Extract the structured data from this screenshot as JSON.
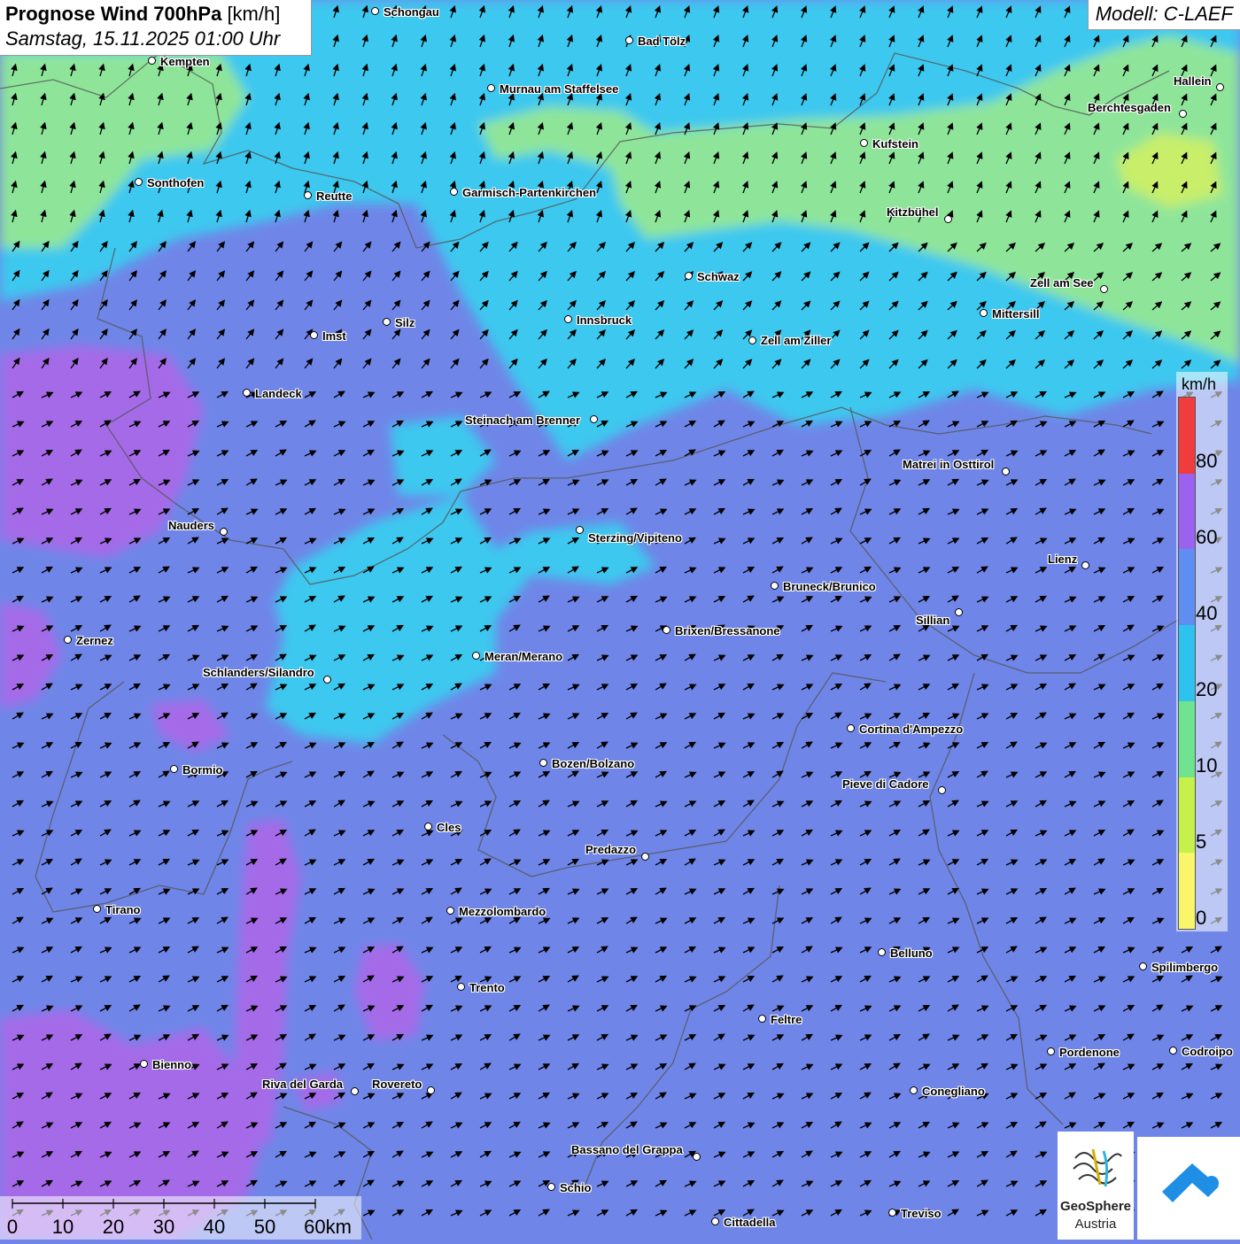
{
  "header": {
    "title_bold": "Prognose Wind 700hPa",
    "title_unit": "[km/h]",
    "datetime": "Samstag, 15.11.2025 01:00 Uhr",
    "model": "Modell: C-LAEF"
  },
  "legend": {
    "unit": "km/h",
    "labels": [
      "80",
      "60",
      "40",
      "20",
      "10",
      "5",
      "0"
    ],
    "colors": [
      "#f03c3c",
      "#9a62ee",
      "#5f8ef2",
      "#2ec3ee",
      "#6fe38f",
      "#c6f04a",
      "#f9f66a"
    ]
  },
  "scalebar": {
    "labels": [
      "0",
      "10",
      "20",
      "30",
      "40",
      "50",
      "60km"
    ]
  },
  "logos": {
    "geosphere_line1": "GeoSphere",
    "geosphere_line2": "Austria"
  },
  "cities": [
    {
      "name": "Schongau"
    },
    {
      "name": "Bad Tölz"
    },
    {
      "name": "Kempten"
    },
    {
      "name": "Murnau am Staffelsee"
    },
    {
      "name": "Hallein"
    },
    {
      "name": "Berchtesgaden"
    },
    {
      "name": "Kufstein"
    },
    {
      "name": "Sonthofen"
    },
    {
      "name": "Reutte"
    },
    {
      "name": "Garmisch-Partenkirchen"
    },
    {
      "name": "Kitzbühel"
    },
    {
      "name": "Schwaz"
    },
    {
      "name": "Zell am See"
    },
    {
      "name": "Mittersill"
    },
    {
      "name": "Innsbruck"
    },
    {
      "name": "Silz"
    },
    {
      "name": "Imst"
    },
    {
      "name": "Zell am Ziller"
    },
    {
      "name": "Landeck"
    },
    {
      "name": "Steinach am Brenner"
    },
    {
      "name": "Matrei in Osttirol"
    },
    {
      "name": "Nauders"
    },
    {
      "name": "Sterzing/Vipiteno"
    },
    {
      "name": "Lienz"
    },
    {
      "name": "Bruneck/Brunico"
    },
    {
      "name": "Sillian"
    },
    {
      "name": "Brixen/Bressanone"
    },
    {
      "name": "Zernez"
    },
    {
      "name": "Meran/Merano"
    },
    {
      "name": "Schlanders/Silandro"
    },
    {
      "name": "Cortina d'Ampezzo"
    },
    {
      "name": "Bozen/Bolzano"
    },
    {
      "name": "Bormio"
    },
    {
      "name": "Pieve di Cadore"
    },
    {
      "name": "Cles"
    },
    {
      "name": "Predazzo"
    },
    {
      "name": "Tirano"
    },
    {
      "name": "Mezzolombardo"
    },
    {
      "name": "Belluno"
    },
    {
      "name": "Spilimbergo"
    },
    {
      "name": "Trento"
    },
    {
      "name": "Feltre"
    },
    {
      "name": "Pordenone"
    },
    {
      "name": "Codroipo"
    },
    {
      "name": "Bienno"
    },
    {
      "name": "Riva del Garda"
    },
    {
      "name": "Rovereto"
    },
    {
      "name": "Conegliano"
    },
    {
      "name": "Bassano del Grappa"
    },
    {
      "name": "Schio"
    },
    {
      "name": "Treviso"
    },
    {
      "name": "Cittadella"
    }
  ]
}
